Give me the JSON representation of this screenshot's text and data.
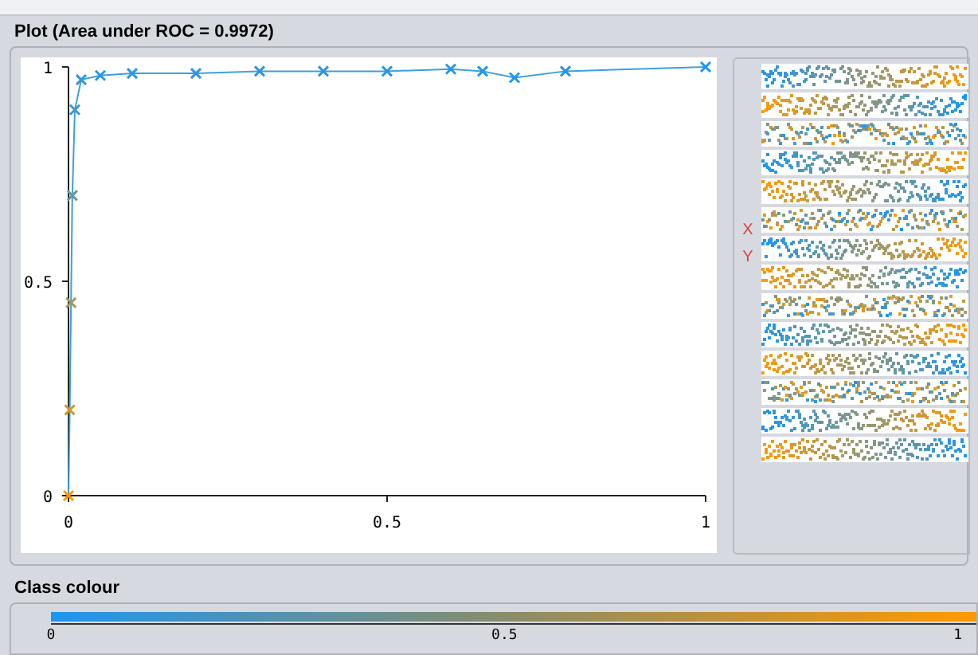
{
  "plot_panel": {
    "title": "Plot (Area under ROC = 0.9972)",
    "chart_data": {
      "type": "line",
      "x": [
        0,
        0.002,
        0.004,
        0.006,
        0.01,
        0.02,
        0.05,
        0.1,
        0.2,
        0.3,
        0.4,
        0.5,
        0.6,
        0.65,
        0.7,
        0.78,
        1
      ],
      "xlim": [
        0,
        1
      ],
      "ylim": [
        0,
        1
      ],
      "xticks": [
        0,
        0.5,
        1
      ],
      "yticks": [
        0,
        0.5,
        1
      ],
      "series": [
        {
          "color": "#3ba0e0",
          "marker": "x",
          "values": [
            0,
            0.2,
            0.45,
            0.7,
            0.9,
            0.97,
            0.98,
            0.985,
            0.985,
            0.99,
            0.99,
            0.99,
            0.995,
            0.99,
            0.975,
            0.99,
            1
          ]
        }
      ]
    }
  },
  "attribute_panel": {
    "axis_markers": [
      "X",
      "Y"
    ]
  },
  "class_colour": {
    "title": "Class colour",
    "ticks": [
      "0",
      "0.5",
      "1"
    ]
  }
}
